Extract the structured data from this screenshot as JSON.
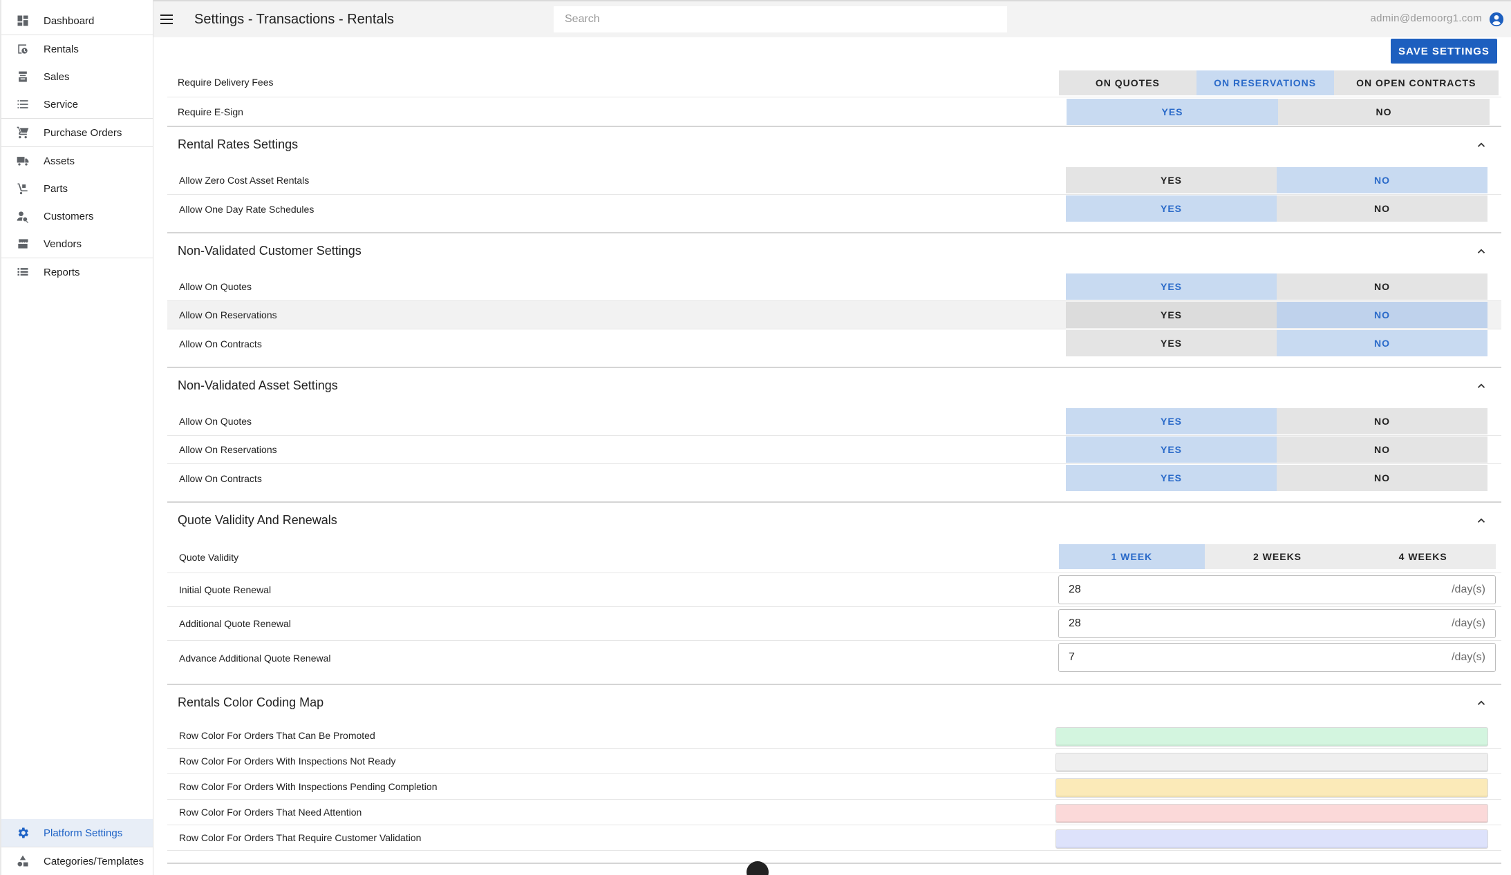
{
  "sidebar": {
    "items": [
      {
        "label": "Dashboard",
        "icon": "dashboard-icon"
      },
      {
        "label": "Rentals",
        "icon": "rentals-icon"
      },
      {
        "label": "Sales",
        "icon": "sales-icon"
      },
      {
        "label": "Service",
        "icon": "service-icon"
      },
      {
        "label": "Purchase Orders",
        "icon": "cart-icon"
      },
      {
        "label": "Assets",
        "icon": "truck-icon"
      },
      {
        "label": "Parts",
        "icon": "hand-truck-icon"
      },
      {
        "label": "Customers",
        "icon": "customers-icon"
      },
      {
        "label": "Vendors",
        "icon": "store-icon"
      },
      {
        "label": "Reports",
        "icon": "list-icon"
      }
    ],
    "bottom_items": [
      {
        "label": "Platform Settings",
        "icon": "gear-icon",
        "active": true
      },
      {
        "label": "Categories/Templates",
        "icon": "shapes-icon"
      }
    ]
  },
  "header": {
    "title": "Settings - Transactions - Rentals",
    "search_placeholder": "Search",
    "user_email": "admin@demoorg1.com"
  },
  "actions": {
    "save_label": "SAVE SETTINGS"
  },
  "general": {
    "delivery_fees": {
      "label": "Require Delivery Fees",
      "options": [
        "ON QUOTES",
        "ON RESERVATIONS",
        "ON OPEN CONTRACTS"
      ],
      "selected": "ON RESERVATIONS"
    },
    "esign": {
      "label": "Require E-Sign",
      "options": [
        "YES",
        "NO"
      ],
      "selected": "YES"
    }
  },
  "rental_rates": {
    "title": "Rental Rates Settings",
    "rows": [
      {
        "label": "Allow Zero Cost Asset Rentals",
        "yes": "YES",
        "no": "NO",
        "selected": "NO"
      },
      {
        "label": "Allow One Day Rate Schedules",
        "yes": "YES",
        "no": "NO",
        "selected": "YES"
      }
    ]
  },
  "non_validated_customer": {
    "title": "Non-Validated Customer Settings",
    "rows": [
      {
        "label": "Allow On Quotes",
        "yes": "YES",
        "no": "NO",
        "selected": "YES"
      },
      {
        "label": "Allow On Reservations",
        "yes": "YES",
        "no": "NO",
        "selected": "NO"
      },
      {
        "label": "Allow On Contracts",
        "yes": "YES",
        "no": "NO",
        "selected": "NO"
      }
    ]
  },
  "non_validated_asset": {
    "title": "Non-Validated Asset Settings",
    "rows": [
      {
        "label": "Allow On Quotes",
        "yes": "YES",
        "no": "NO",
        "selected": "YES"
      },
      {
        "label": "Allow On Reservations",
        "yes": "YES",
        "no": "NO",
        "selected": "YES"
      },
      {
        "label": "Allow On Contracts",
        "yes": "YES",
        "no": "NO",
        "selected": "YES"
      }
    ]
  },
  "quote_validity": {
    "title": "Quote Validity And Renewals",
    "validity": {
      "label": "Quote Validity",
      "options": [
        "1 WEEK",
        "2 WEEKS",
        "4 WEEKS"
      ],
      "selected": "1 WEEK"
    },
    "initial": {
      "label": "Initial Quote Renewal",
      "value": "28",
      "unit": "/day(s)"
    },
    "additional": {
      "label": "Additional Quote Renewal",
      "value": "28",
      "unit": "/day(s)"
    },
    "advance": {
      "label": "Advance Additional Quote Renewal",
      "value": "7",
      "unit": "/day(s)"
    }
  },
  "color_map": {
    "title": "Rentals Color Coding Map",
    "rows": [
      {
        "label": "Row Color For Orders That Can Be Promoted",
        "color": "#d3f5df"
      },
      {
        "label": "Row Color For Orders With Inspections Not Ready",
        "color": "#efefef"
      },
      {
        "label": "Row Color For Orders With Inspections Pending Completion",
        "color": "#fbeab8"
      },
      {
        "label": "Row Color For Orders That Need Attention",
        "color": "#fbd9d9"
      },
      {
        "label": "Row Color For Orders That Require Customer Validation",
        "color": "#dde2fb"
      }
    ]
  }
}
